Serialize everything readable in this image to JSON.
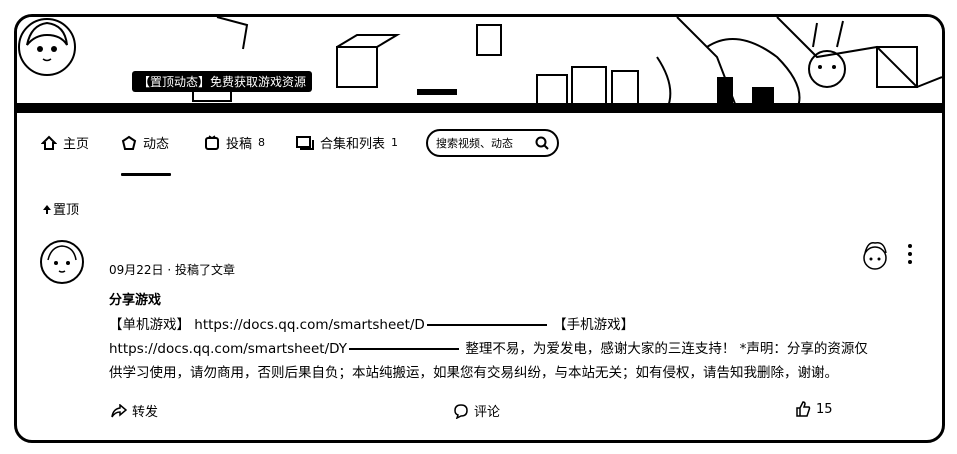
{
  "banner": {
    "title": "【置顶动态】免费获取游戏资源"
  },
  "nav": {
    "items": [
      {
        "label": "主页",
        "icon": "home-icon"
      },
      {
        "label": "动态",
        "icon": "dynamic-icon"
      },
      {
        "label": "投稿",
        "icon": "upload-icon",
        "count": "8"
      },
      {
        "label": "合集和列表",
        "icon": "collection-icon",
        "count": "1"
      }
    ],
    "active": "动态"
  },
  "search": {
    "placeholder": "搜索视频、动态"
  },
  "pinned": {
    "label": "置顶"
  },
  "post": {
    "meta": "09月22日 · 投稿了文章",
    "title": "分享游戏",
    "line1_a": "【单机游戏】 https://docs.qq.com/smartsheet/D",
    "line1_b": "【手机游戏】",
    "line2_a": "https://docs.qq.com/smartsheet/DY",
    "line2_b": "整理不易，为爱发电，感谢大家的三连支持！ *声明：分享的资源仅",
    "line3": "供学习使用，请勿商用，否则后果自负；本站纯搬运，如果您有交易纠纷，与本站无关；如有侵权，请告知我删除，谢谢。"
  },
  "actions": {
    "share": "转发",
    "comment": "评论",
    "like_count": "15"
  }
}
